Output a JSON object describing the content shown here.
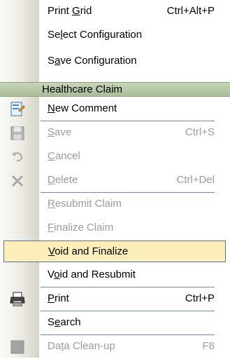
{
  "menu": {
    "items_top": [
      {
        "pre": "Print ",
        "u": "G",
        "post": "rid",
        "shortcut": "Ctrl+Alt+P"
      },
      {
        "pre": "Se",
        "u": "l",
        "post": "ect Configuration",
        "shortcut": ""
      },
      {
        "pre": "S",
        "u": "a",
        "post": "ve Configuration",
        "shortcut": ""
      }
    ],
    "section_header": "Healthcare Claim",
    "items": [
      {
        "pre": "",
        "u": "N",
        "post": "ew Comment",
        "shortcut": "",
        "disabled": false,
        "icon": "new-comment-icon"
      },
      {
        "pre": "",
        "u": "S",
        "post": "ave",
        "shortcut": "Ctrl+S",
        "disabled": true,
        "icon": "save-icon"
      },
      {
        "pre": "",
        "u": "C",
        "post": "ancel",
        "shortcut": "",
        "disabled": true,
        "icon": "undo-icon"
      },
      {
        "pre": "",
        "u": "D",
        "post": "elete",
        "shortcut": "Ctrl+Del",
        "disabled": true,
        "icon": "delete-icon"
      },
      {
        "pre": "",
        "u": "R",
        "post": "esubmit Claim",
        "shortcut": "",
        "disabled": true,
        "icon": ""
      },
      {
        "pre": "",
        "u": "F",
        "post": "inalize Claim",
        "shortcut": "",
        "disabled": true,
        "icon": ""
      },
      {
        "pre": "",
        "u": "V",
        "post": "oid and Finalize",
        "shortcut": "",
        "disabled": false,
        "icon": "",
        "highlighted": true
      },
      {
        "pre": "V",
        "u": "o",
        "post": "id and Resubmit",
        "shortcut": "",
        "disabled": false,
        "icon": ""
      },
      {
        "pre": "",
        "u": "P",
        "post": "rint",
        "shortcut": "Ctrl+P",
        "disabled": false,
        "icon": "printer-icon"
      },
      {
        "pre": "S",
        "u": "e",
        "post": "arch",
        "shortcut": "",
        "disabled": false,
        "icon": ""
      },
      {
        "pre": "Da",
        "u": "t",
        "post": "a Clean-up",
        "shortcut": "F8",
        "disabled": true,
        "icon": "data-cleanup-icon"
      }
    ]
  },
  "colors": {
    "highlight_bg": "#fbeeb8",
    "highlight_border": "#5b6e9e",
    "section_header_bg": "#b7c9a6",
    "disabled_text": "#9c9c9c",
    "separator": "#6a88c4"
  }
}
